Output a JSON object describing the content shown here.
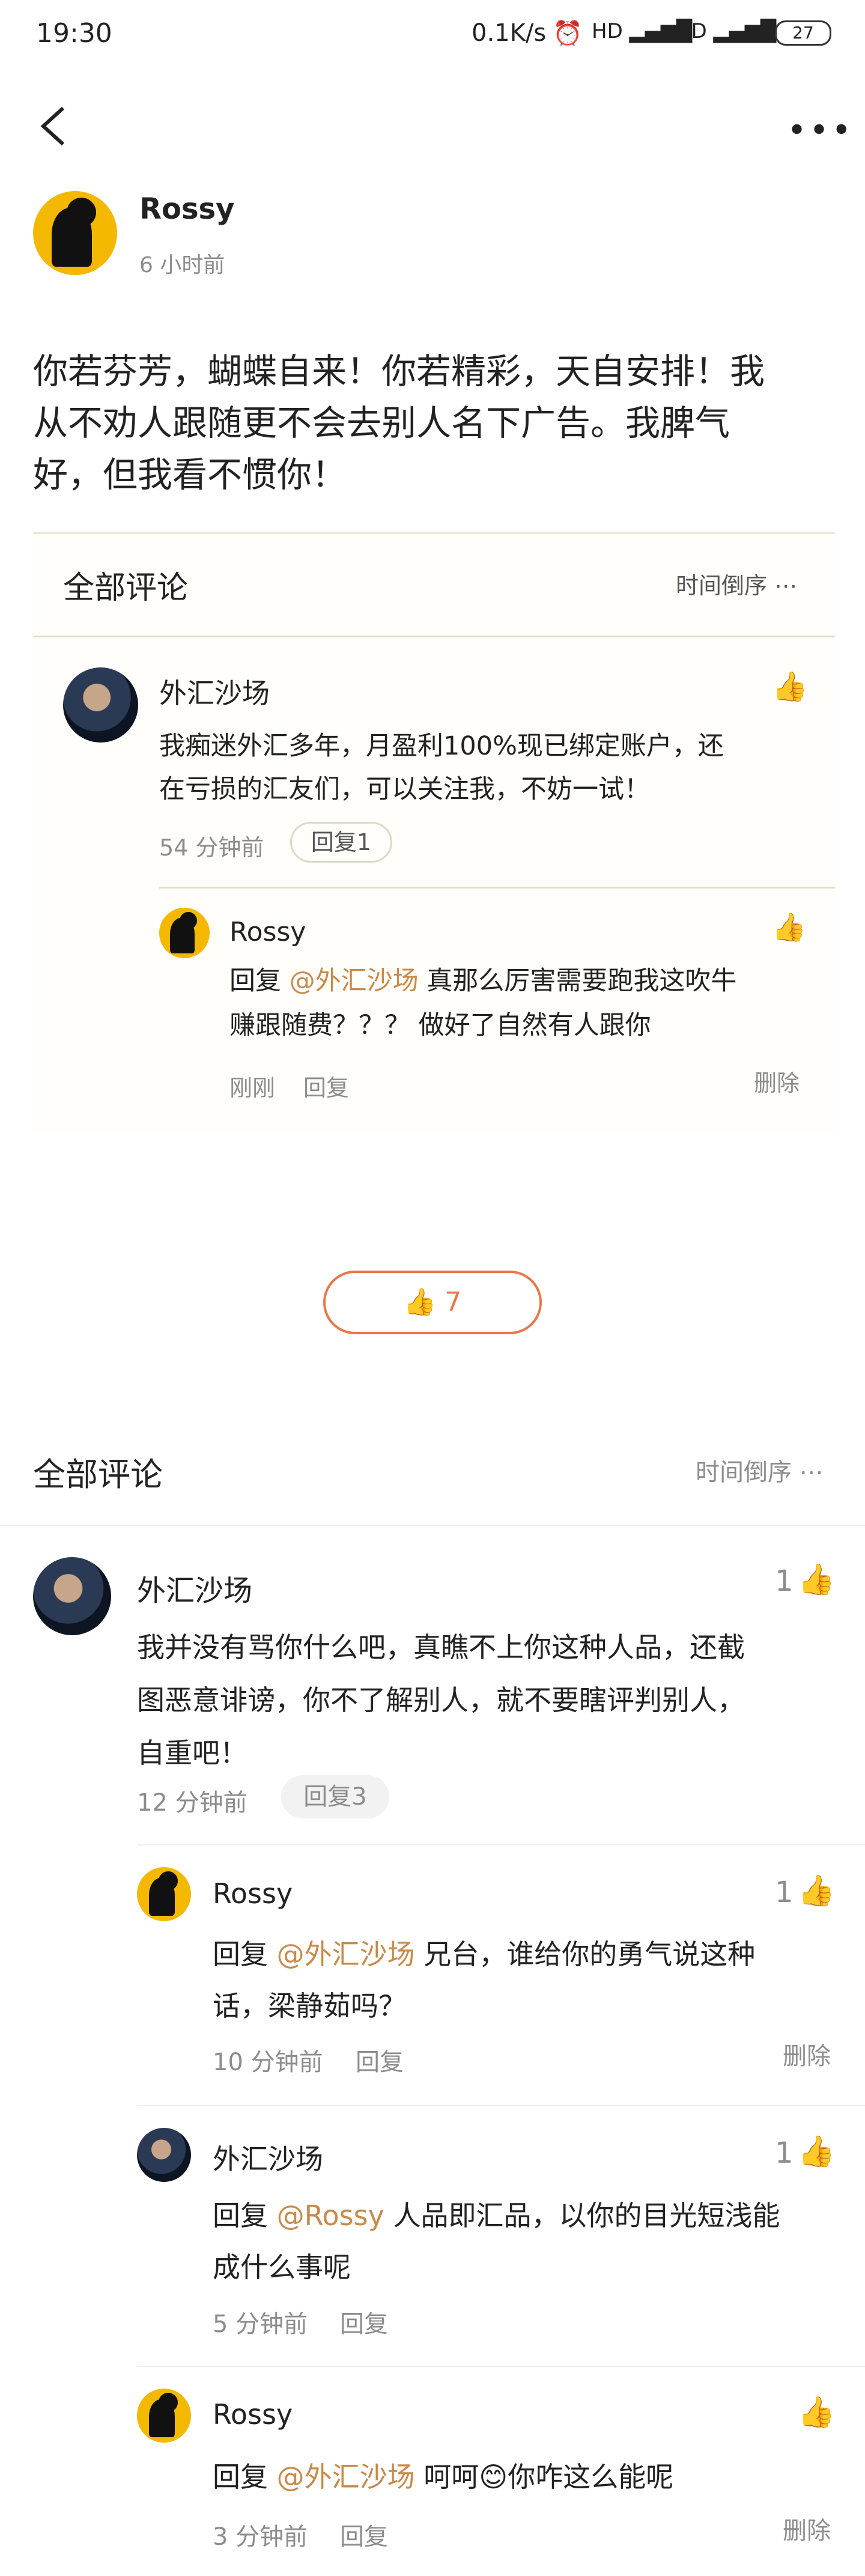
{
  "status_bar": {
    "time": "19:30",
    "speed": "0.1K/s",
    "battery": "27"
  },
  "post": {
    "author": "Rossy",
    "time": "6 小时前",
    "text_lines": [
      "你若芬芳，蝴蝶自来！你若精彩，天自安排！我",
      "从不劝人跟随更不会去别人名下广告。我脾气",
      "好，但我看不惯你！"
    ]
  },
  "quoted_section": {
    "title": "全部评论",
    "sort": "时间倒序 ⋯",
    "comment": {
      "author": "外汇沙场",
      "text_lines": [
        "我痴迷外汇多年，月盈利100%现已绑定账户，还",
        "在亏损的汇友们，可以关注我，不妨一试！"
      ],
      "time": "54 分钟前",
      "reply_btn": "回复1"
    },
    "reply": {
      "author": "Rossy",
      "prefix": "回复 ",
      "mention": "@外汇沙场",
      "text_line1": " 真那么厉害需要跑我这吹牛",
      "text_line2": "赚跟随费？？？ 做好了自然有人跟你",
      "time": "刚刚",
      "reply": "回复",
      "delete": "删除"
    }
  },
  "like_button": {
    "count": "7"
  },
  "comments_section": {
    "title": "全部评论",
    "sort": "时间倒序 ⋯",
    "main_comment": {
      "author": "外汇沙场",
      "likes": "1",
      "text_lines": [
        "我并没有骂你什么吧，真瞧不上你这种人品，还截",
        "图恶意诽谤，你不了解别人，就不要瞎评判别人，",
        "自重吧！"
      ],
      "time": "12 分钟前",
      "reply_btn": "回复3"
    },
    "replies": [
      {
        "author": "Rossy",
        "likes": "1",
        "prefix": "回复 ",
        "mention": "@外汇沙场",
        "text1": " 兄台，谁给你的勇气说这种",
        "text2": "话，梁静茹吗？",
        "time": "10 分钟前",
        "reply": "回复",
        "delete": "删除"
      },
      {
        "author": "外汇沙场",
        "likes": "1",
        "prefix": "回复 ",
        "mention": "@Rossy",
        "text1": " 人品即汇品，以你的目光短浅能",
        "text2": "成什么事呢",
        "time": "5 分钟前",
        "reply": "回复"
      },
      {
        "author": "Rossy",
        "likes": "",
        "prefix": "回复 ",
        "mention": "@外汇沙场",
        "text1": " 呵呵😊你咋这么能呢",
        "text2": "",
        "time": "3 分钟前",
        "reply": "回复",
        "delete": "删除"
      }
    ]
  },
  "colors": {
    "accent_orange": "#e8774a",
    "link_gold": "#c98a4b",
    "text_gray": "#8c8c8c"
  }
}
